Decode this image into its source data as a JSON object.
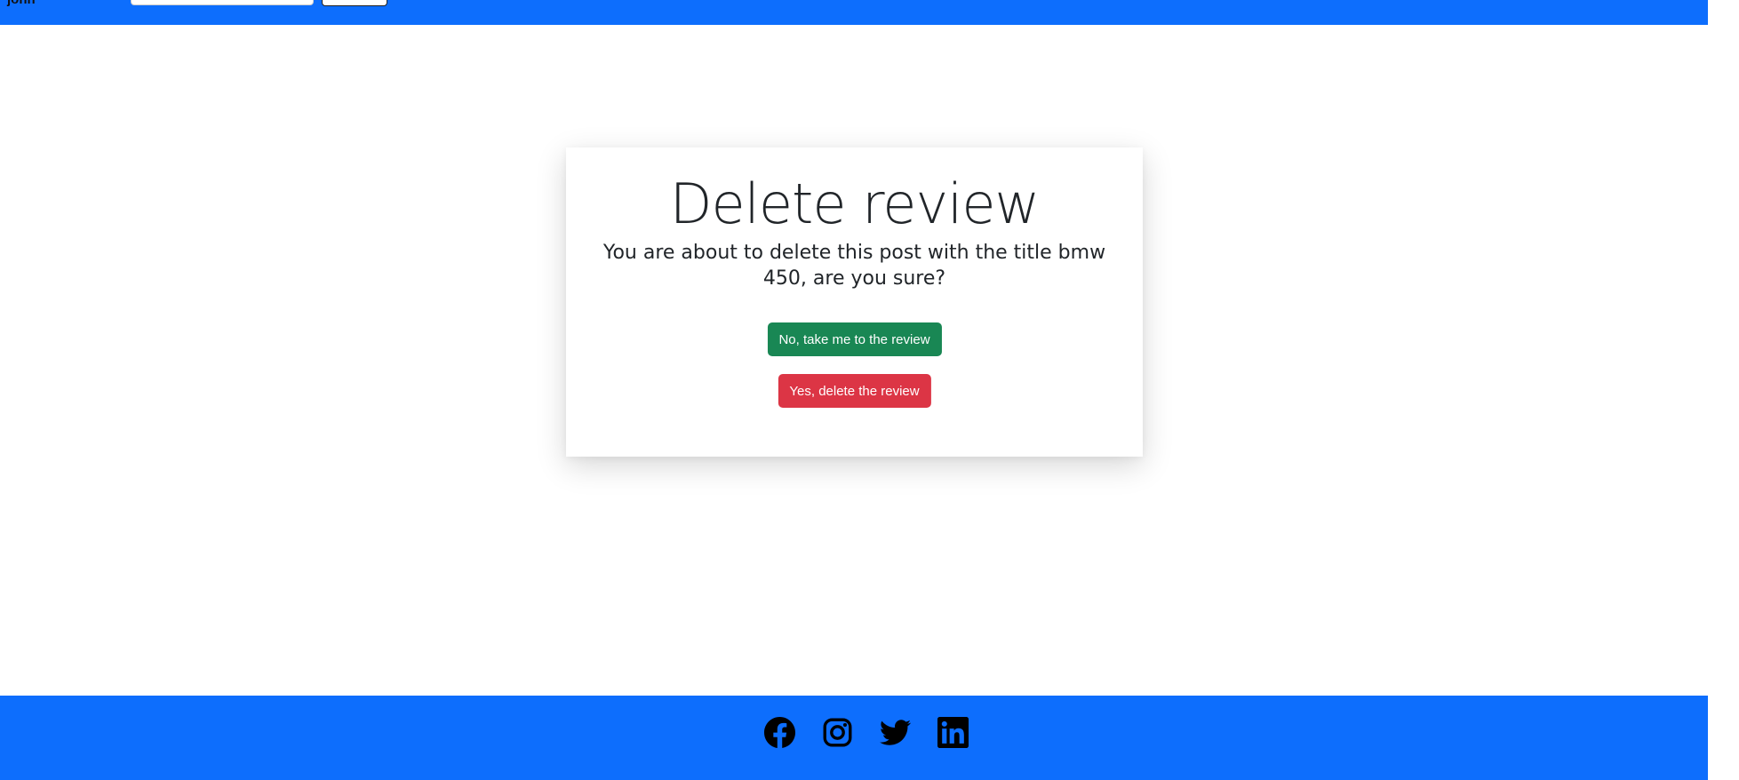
{
  "header": {
    "user_name": "john",
    "search": {
      "placeholder": "",
      "button_label": ""
    }
  },
  "card": {
    "title": "Delete review",
    "message": "You are about to delete this post with the title bmw 450, are you sure?",
    "cancel_label": "No, take me to the review",
    "confirm_label": "Yes, delete the review"
  },
  "footer": {
    "social": [
      "facebook-icon",
      "instagram-icon",
      "twitter-icon",
      "linkedin-icon"
    ]
  },
  "colors": {
    "brand_blue": "#0d6efd",
    "success": "#198754",
    "danger": "#dc3545",
    "text": "#212529"
  }
}
